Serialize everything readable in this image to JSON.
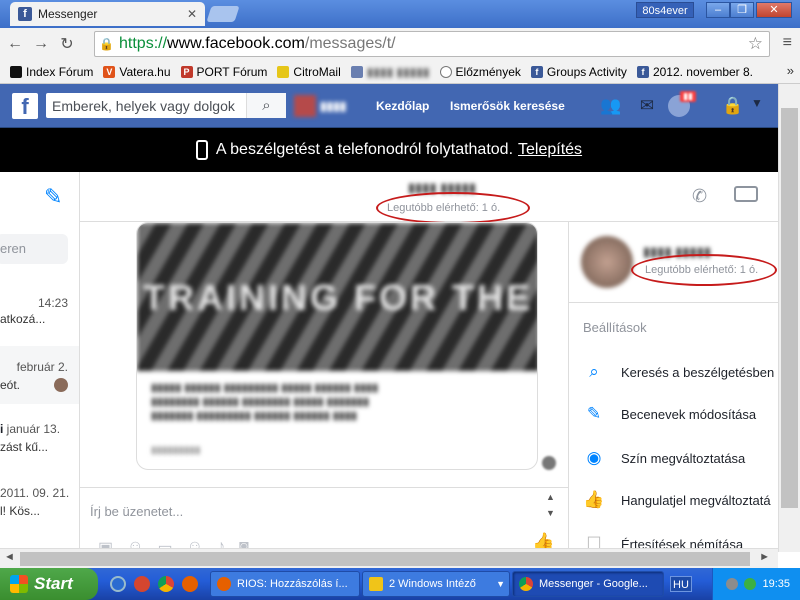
{
  "browser": {
    "tab_title": "Messenger",
    "user_badge": "80s4ever",
    "url_scheme": "https://",
    "url_domain": "www.facebook.com",
    "url_path": "/messages/t/"
  },
  "bookmarks": [
    {
      "label": "Index Fórum",
      "icon_color": "#111111"
    },
    {
      "label": "Vatera.hu",
      "icon_color": "#e0531a"
    },
    {
      "label": "PORT Fórum",
      "icon_color": "#c0392b"
    },
    {
      "label": "CitroMail",
      "icon_color": "#e6c619"
    },
    {
      "label": "Előzmények",
      "icon_color": "#555555"
    },
    {
      "label": "Groups Activity",
      "icon_color": "#3b5998"
    },
    {
      "label": "2012. november 8.",
      "icon_color": "#3b5998"
    }
  ],
  "fb": {
    "search_placeholder": "Emberek, helyek vagy dolgok",
    "home_link": "Kezdőlap",
    "find_friends_link": "Ismerősök keresése"
  },
  "banner": {
    "text": "A beszélgetést a telefonodról folytathatod.",
    "install": "Telepítés"
  },
  "conversations": {
    "search_placeholder": "eren",
    "items": [
      {
        "time": "14:23",
        "snippet": "atkozá..."
      },
      {
        "time": "február 2.",
        "snippet": "eót."
      },
      {
        "time": "január 13.",
        "snippet": "zást kű..."
      },
      {
        "time": "2011. 09. 21.",
        "snippet": "l! Kös..."
      }
    ]
  },
  "chat": {
    "status": "Legutóbb elérhető: 1 ó.",
    "composer_placeholder": "Írj be üzenetet...",
    "card_image_text": "TRAINING FOR THE"
  },
  "right_panel": {
    "status": "Legutóbb elérhető: 1 ó.",
    "settings_title": "Beállítások",
    "items": [
      {
        "label": "Keresés a beszélgetésben",
        "icon": "search-icon"
      },
      {
        "label": "Becenevek módosítása",
        "icon": "pencil-icon"
      },
      {
        "label": "Szín megváltoztatása",
        "icon": "palette-icon"
      },
      {
        "label": "Hangulatjel megváltoztatá",
        "icon": "thumbs-up-icon"
      },
      {
        "label": "Értesítések némítása",
        "icon": "checkbox-icon"
      }
    ]
  },
  "taskbar": {
    "start": "Start",
    "tasks": [
      {
        "label": "RIOS: Hozzászólás í..."
      },
      {
        "label": "2 Windows Intéző"
      },
      {
        "label": "Messenger - Google..."
      }
    ],
    "lang": "HU",
    "clock": "19:35"
  },
  "colors": {
    "fb_blue": "#4267b2",
    "messenger_blue": "#0084ff",
    "annotation_red": "#c61b1b"
  }
}
